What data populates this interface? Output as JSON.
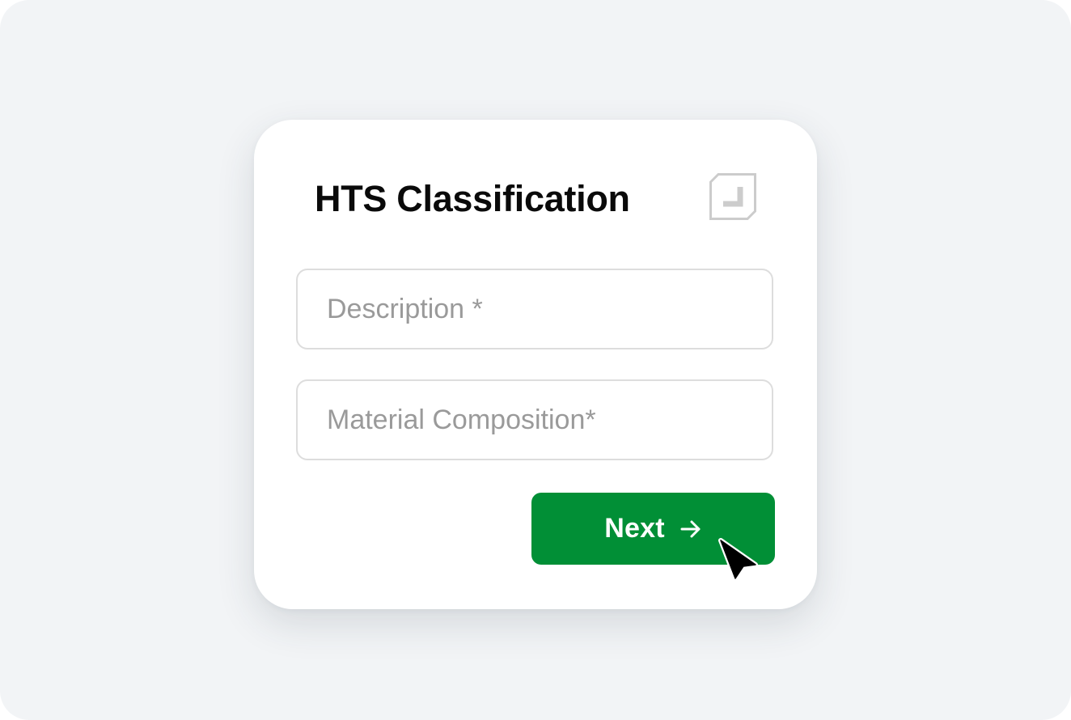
{
  "form": {
    "title": "HTS Classification",
    "logo_icon": "corner-bracket-logo-icon",
    "fields": {
      "description": {
        "value": "",
        "placeholder": "Description *"
      },
      "material_composition": {
        "value": "",
        "placeholder": "Material Composition*"
      }
    },
    "next_button": {
      "label": "Next",
      "icon": "arrow-right-icon"
    }
  },
  "cursor": {
    "icon": "mouse-pointer-icon"
  },
  "colors": {
    "background": "#f2f4f6",
    "card": "#ffffff",
    "accent": "#018f36",
    "placeholder": "#9a9a9a",
    "field_border": "#dddddd",
    "logo": "#cccccc"
  }
}
